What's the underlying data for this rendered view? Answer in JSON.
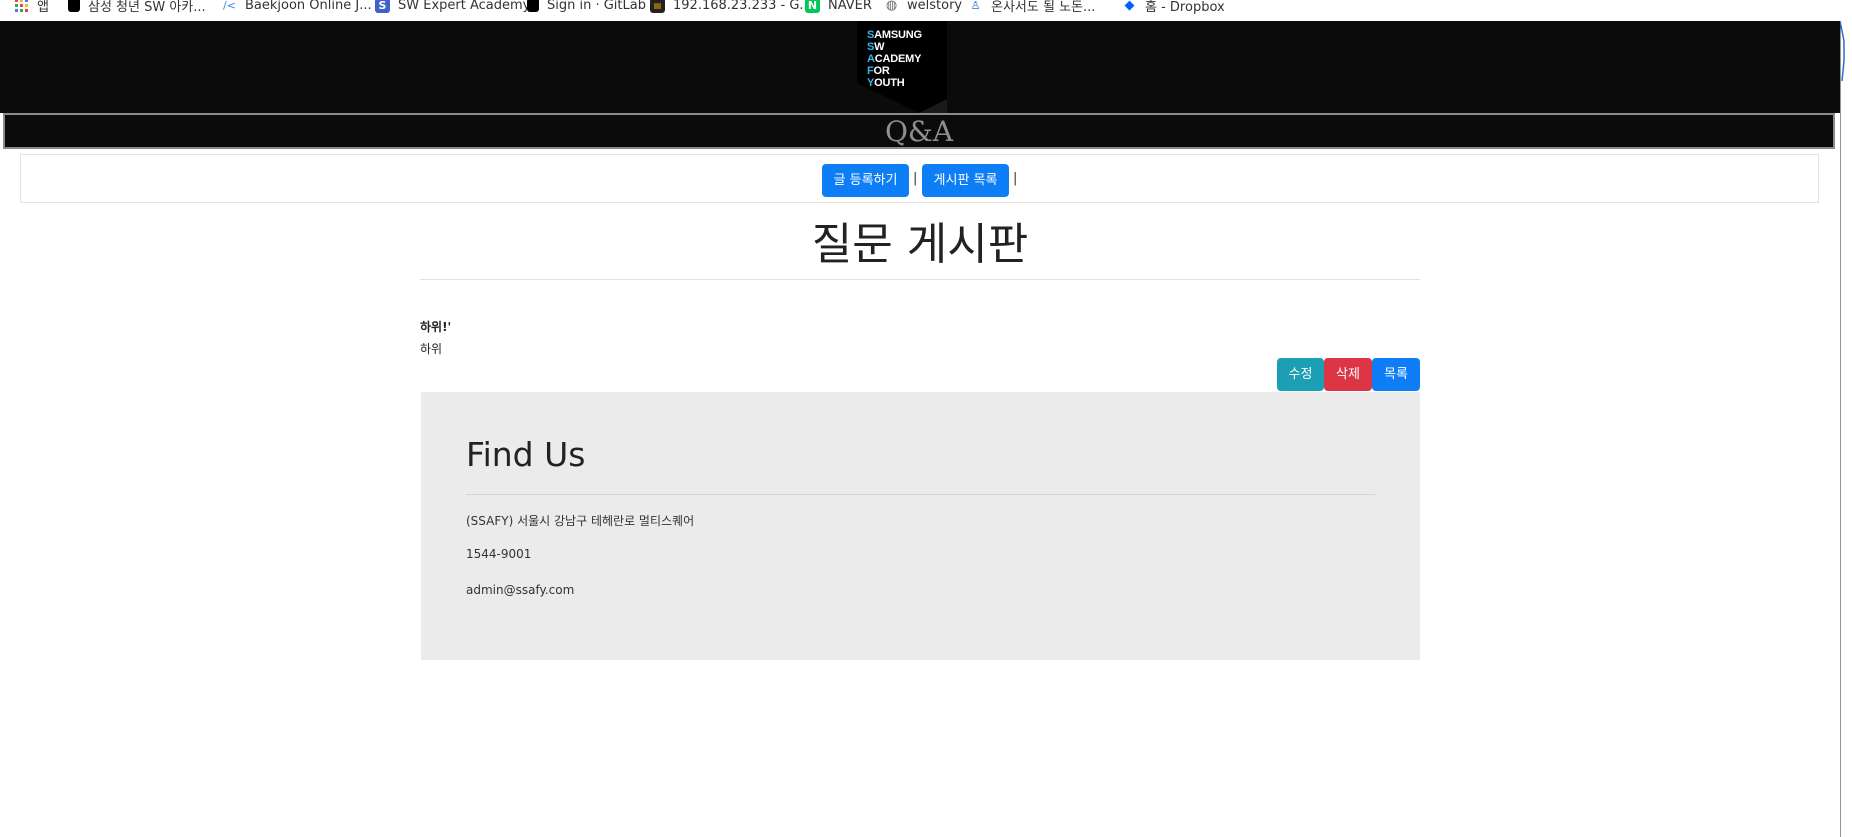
{
  "bookmarks": [
    {
      "label": "앱",
      "icon": "apps-grid-icon",
      "color": "#e8453c"
    },
    {
      "label": "삼성 청년 SW 아카...",
      "icon": "ssafy-favicon-icon",
      "color": "#000000"
    },
    {
      "label": "Baekjoon Online J...",
      "icon": "code-brackets-icon",
      "color": "#3b82f6"
    },
    {
      "label": "SW Expert Academy",
      "icon": "s-square-icon",
      "color": "#3f62c8"
    },
    {
      "label": "Sign in · GitLab",
      "icon": "ssafy-favicon-icon",
      "color": "#000000"
    },
    {
      "label": "192.168.23.233 - G...",
      "icon": "kiosk-icon",
      "color": "#e07b00"
    },
    {
      "label": "NAVER",
      "icon": "naver-n-icon",
      "color": "#03c75a"
    },
    {
      "label": "welstory",
      "icon": "globe-icon",
      "color": "#666666"
    },
    {
      "label": "온사서도 될 노돈...",
      "icon": "person-icon",
      "color": "#1f6fd1"
    },
    {
      "label": "홈 - Dropbox",
      "icon": "dropbox-icon",
      "color": "#0061fe"
    }
  ],
  "header": {
    "logo_lines": [
      "SAMSUNG",
      "SW",
      "ACADEMY",
      "FOR",
      "YOUTH"
    ],
    "logo_first_letters": [
      "S",
      "S",
      "A",
      "F",
      "Y"
    ],
    "logo_rest": [
      "AMSUNG",
      "W",
      "CADEMY",
      "OR",
      "OUTH"
    ],
    "logo_accent": "#2fb7ea"
  },
  "banner": {
    "title": "Q&A"
  },
  "nav": {
    "write_label": "글 등록하기",
    "list_label": "게시판 목록",
    "separator": "|"
  },
  "board": {
    "title": "질문 게시판"
  },
  "post": {
    "title": "하위!'",
    "body": "하위",
    "edit_label": "수정",
    "delete_label": "삭제",
    "list_label": "목록"
  },
  "footer": {
    "title": "Find Us",
    "address": "(SSAFY) 서울시 강남구 테헤란로 멀티스퀘어",
    "phone": "1544-9001",
    "email": "admin@ssafy.com"
  }
}
